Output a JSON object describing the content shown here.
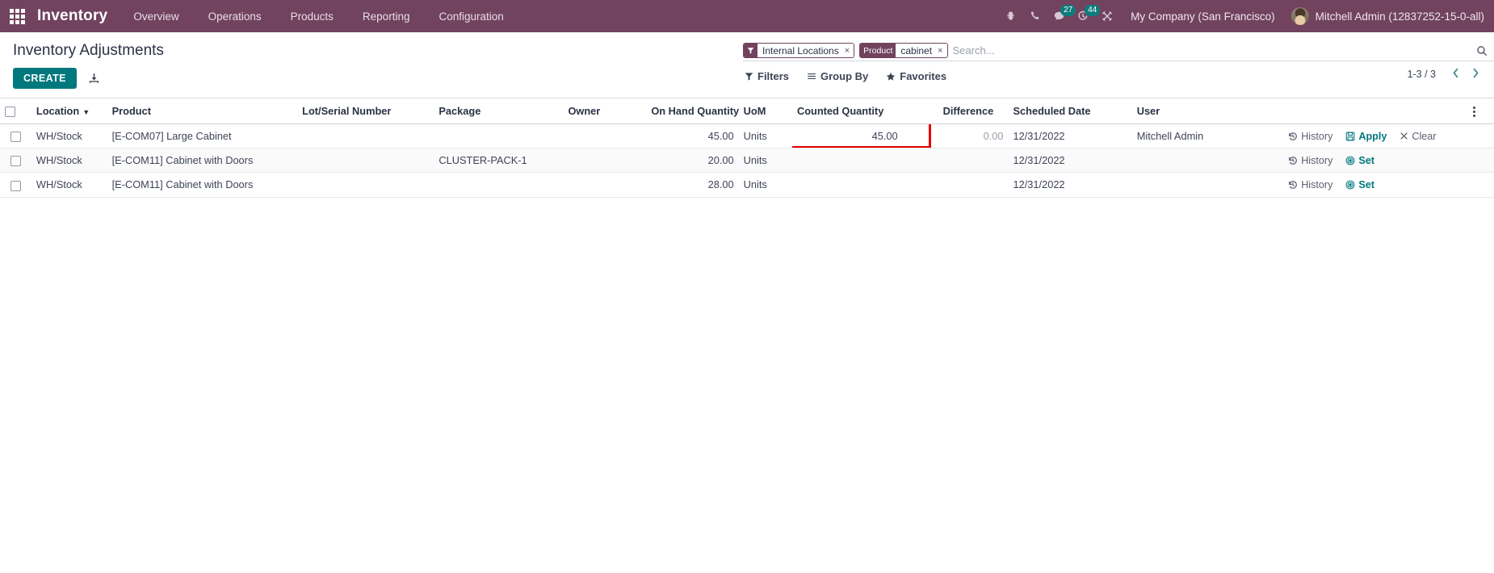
{
  "navbar": {
    "apps_icon": "apps-grid-icon",
    "brand": "Inventory",
    "menu": [
      {
        "label": "Overview"
      },
      {
        "label": "Operations"
      },
      {
        "label": "Products"
      },
      {
        "label": "Reporting"
      },
      {
        "label": "Configuration"
      }
    ],
    "sys_icons": [
      {
        "name": "bug-icon",
        "badge": ""
      },
      {
        "name": "phone-icon",
        "badge": ""
      },
      {
        "name": "messages-icon",
        "badge": "27"
      },
      {
        "name": "activities-icon",
        "badge": "44"
      },
      {
        "name": "tools-icon",
        "badge": ""
      }
    ],
    "company": "My Company (San Francisco)",
    "user": "Mitchell Admin (12837252-15-0-all)",
    "accent_color": "#71435f",
    "badge_color": "#0d7c7c"
  },
  "control_panel": {
    "title": "Inventory Adjustments",
    "create_label": "CREATE",
    "import_icon": "import-download-icon",
    "search": {
      "placeholder": "Search...",
      "search_icon": "search-icon",
      "facets": [
        {
          "icon": "filter-funnel-icon",
          "label": "",
          "value": "Internal Locations",
          "remove": "×"
        },
        {
          "icon": "",
          "label": "Product",
          "value": "cabinet",
          "remove": "×"
        }
      ]
    },
    "filters": [
      {
        "icon": "filter-funnel-icon",
        "label": "Filters"
      },
      {
        "icon": "group-by-icon",
        "label": "Group By"
      },
      {
        "icon": "star-icon",
        "label": "Favorites"
      }
    ],
    "pager": {
      "value": "1-3 / 3",
      "prev": "‹",
      "next": "›"
    }
  },
  "table": {
    "columns": [
      {
        "key": "check",
        "label": ""
      },
      {
        "key": "location",
        "label": "Location",
        "sorted": true
      },
      {
        "key": "product",
        "label": "Product"
      },
      {
        "key": "lot",
        "label": "Lot/Serial Number"
      },
      {
        "key": "package",
        "label": "Package"
      },
      {
        "key": "owner",
        "label": "Owner"
      },
      {
        "key": "onhand",
        "label": "On Hand Quantity"
      },
      {
        "key": "uom",
        "label": "UoM"
      },
      {
        "key": "counted",
        "label": "Counted Quantity"
      },
      {
        "key": "diff",
        "label": "Difference"
      },
      {
        "key": "sched",
        "label": "Scheduled Date"
      },
      {
        "key": "user",
        "label": "User"
      },
      {
        "key": "actions",
        "label": ""
      },
      {
        "key": "opt",
        "label": ""
      }
    ],
    "rows": [
      {
        "location": "WH/Stock",
        "product": "[E-COM07] Large Cabinet",
        "lot": "",
        "package": "",
        "owner": "",
        "onhand": "45.00",
        "uom": "Units",
        "counted": "45.00",
        "diff": "0.00",
        "sched": "12/31/2022",
        "user": "Mitchell Admin",
        "actions": [
          {
            "name": "history",
            "label": "History",
            "icon": "history-icon",
            "style": "gray"
          },
          {
            "name": "apply",
            "label": "Apply",
            "icon": "save-floppy-icon",
            "style": "teal"
          },
          {
            "name": "clear",
            "label": "Clear",
            "icon": "clear-x-icon",
            "style": "gray"
          }
        ],
        "highlighted_cell": "counted"
      },
      {
        "location": "WH/Stock",
        "product": "[E-COM11] Cabinet with Doors",
        "lot": "",
        "package": "CLUSTER-PACK-1",
        "owner": "",
        "onhand": "20.00",
        "uom": "Units",
        "counted": "",
        "diff": "",
        "sched": "12/31/2022",
        "user": "",
        "actions": [
          {
            "name": "history",
            "label": "History",
            "icon": "history-icon",
            "style": "gray"
          },
          {
            "name": "set",
            "label": "Set",
            "icon": "target-bullseye-icon",
            "style": "teal"
          }
        ],
        "highlighted_cell": ""
      },
      {
        "location": "WH/Stock",
        "product": "[E-COM11] Cabinet with Doors",
        "lot": "",
        "package": "",
        "owner": "",
        "onhand": "28.00",
        "uom": "Units",
        "counted": "",
        "diff": "",
        "sched": "12/31/2022",
        "user": "",
        "actions": [
          {
            "name": "history",
            "label": "History",
            "icon": "history-icon",
            "style": "gray"
          },
          {
            "name": "set",
            "label": "Set",
            "icon": "target-bullseye-icon",
            "style": "teal"
          }
        ],
        "highlighted_cell": ""
      }
    ]
  },
  "annotation": {
    "color": "#e60000",
    "target": "counted-quantity-row-1"
  }
}
